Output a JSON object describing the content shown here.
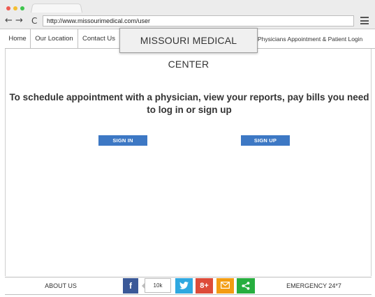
{
  "browser": {
    "url": "http://www.missourimedical.com/user",
    "back_glyph": "←",
    "forward_glyph": "→",
    "reload_glyph": "C"
  },
  "nav": {
    "home": "Home",
    "location": "Our Location",
    "contact": "Contact Us",
    "brand": "MISSOURI MEDICAL CENTER",
    "right_links": "Physicians Appointment & Patient  Login"
  },
  "main": {
    "message": "To schedule appointment with a physician, view your reports, pay bills you need to log in or sign up",
    "signin_label": "SIGN IN",
    "signup_label": "SIGN UP"
  },
  "footer": {
    "about": "ABOUT US",
    "emergency": "EMERGENCY 24*7",
    "facebook_glyph": "f",
    "share_count": "10k",
    "gplus_glyph": "8+"
  },
  "colors": {
    "primary_button": "#3d78c4",
    "facebook": "#3b5998",
    "twitter": "#2fa8e0",
    "google_plus": "#dd4b39",
    "mail": "#f39c12",
    "share": "#27ae3f"
  }
}
